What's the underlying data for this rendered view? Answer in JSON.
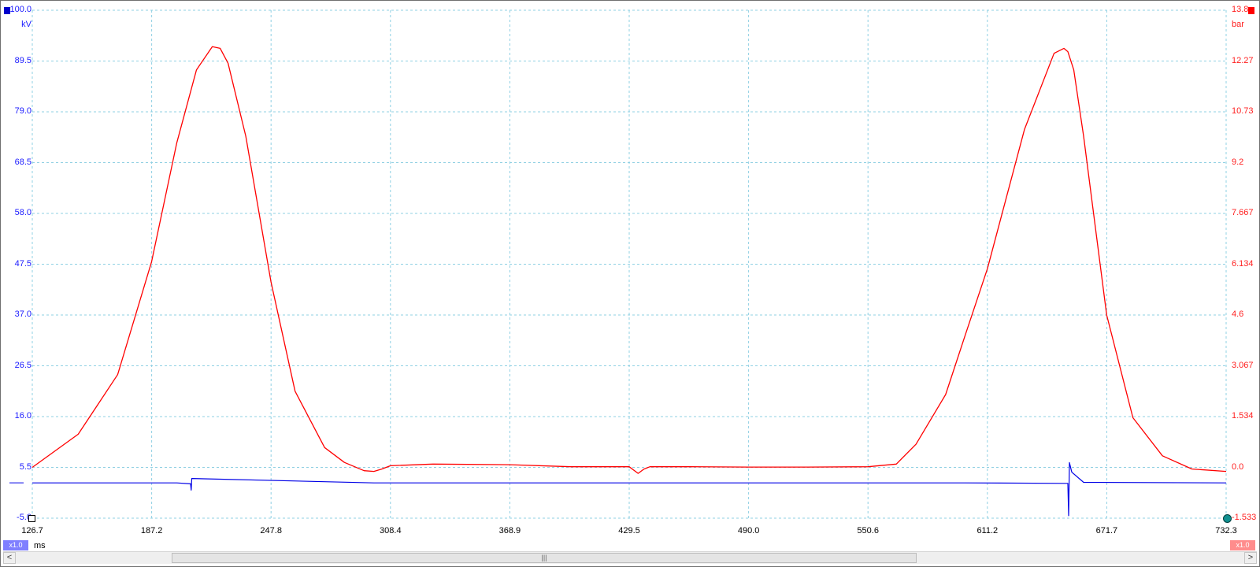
{
  "left_axis": {
    "unit": "kV",
    "ticks": [
      "100.0",
      "89.5",
      "79.0",
      "68.5",
      "58.0",
      "47.5",
      "37.0",
      "26.5",
      "16.0",
      "5.5",
      "-5.0"
    ],
    "color": "#0000e6"
  },
  "right_axis": {
    "unit": "bar",
    "ticks": [
      "13.8",
      "12.27",
      "10.73",
      "9.2",
      "7.667",
      "6.134",
      "4.6",
      "3.067",
      "1.534",
      "0.0",
      "-1.533"
    ],
    "color": "#ff0000"
  },
  "x_axis": {
    "unit": "ms",
    "ticks": [
      "126.7",
      "187.2",
      "247.8",
      "308.4",
      "368.9",
      "429.5",
      "490.0",
      "550.6",
      "611.2",
      "671.7",
      "732.3"
    ]
  },
  "zoom": {
    "left": "x1.0",
    "right": "x1.0"
  },
  "scrollbar": {
    "left_arrow": "<",
    "right_arrow": ">",
    "thumb_grip": "|||"
  },
  "chart_data": {
    "type": "line",
    "grid": true,
    "x_range": [
      126.7,
      732.3
    ],
    "x_unit": "ms",
    "series": [
      {
        "axis": "right",
        "unit": "bar",
        "color": "#ff0000",
        "y_range": [
          -1.533,
          13.8
        ],
        "x": [
          126.7,
          150,
          170,
          187.2,
          200,
          210,
          218,
          222,
          226,
          235,
          247.8,
          260,
          275,
          285,
          295,
          300,
          304,
          308.4,
          330,
          368.9,
          400,
          429.5,
          434,
          437,
          440,
          460,
          490.0,
          520,
          550.6,
          565,
          575,
          590,
          600,
          611.2,
          630,
          645,
          650,
          652,
          655,
          660,
          671.7,
          685,
          700,
          715,
          732.3
        ],
        "y": [
          0.0,
          1.0,
          2.8,
          6.2,
          9.8,
          12.0,
          12.7,
          12.65,
          12.2,
          10.0,
          5.6,
          2.3,
          0.6,
          0.15,
          -0.1,
          -0.12,
          -0.05,
          0.05,
          0.1,
          0.08,
          0.02,
          0.02,
          -0.18,
          -0.05,
          0.02,
          0.02,
          0.01,
          0.01,
          0.02,
          0.1,
          0.7,
          2.2,
          4.0,
          6.0,
          10.2,
          12.5,
          12.65,
          12.55,
          12.0,
          10.0,
          4.6,
          1.5,
          0.35,
          -0.05,
          -0.12
        ]
      },
      {
        "axis": "left",
        "unit": "kV",
        "color": "#0000e6",
        "y_range": [
          -5.0,
          100.0
        ],
        "x": [
          126.7,
          200,
          207,
          207.3,
          207.6,
          300,
          440,
          600,
          652,
          652.4,
          652.8,
          654,
          660,
          732.3
        ],
        "y": [
          2.3,
          2.3,
          2.1,
          0.8,
          3.2,
          2.3,
          2.3,
          2.3,
          2.2,
          -4.5,
          6.5,
          4.5,
          2.4,
          2.3
        ]
      }
    ]
  }
}
